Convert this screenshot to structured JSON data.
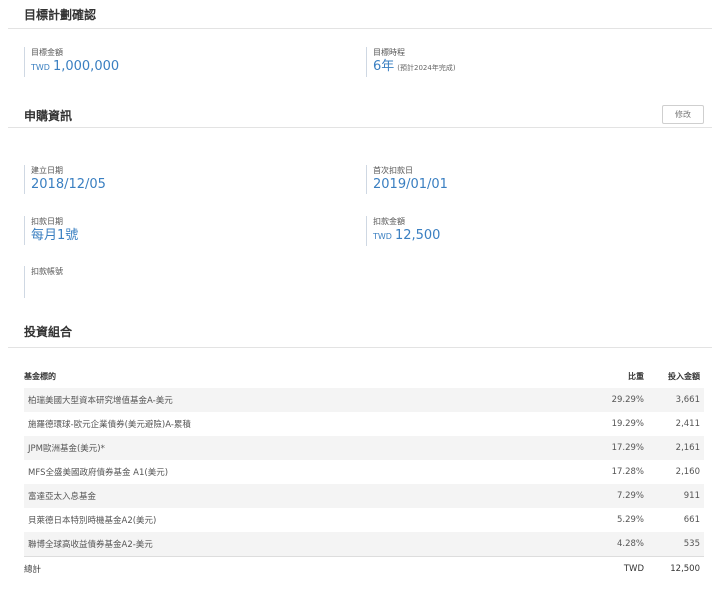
{
  "goal": {
    "title": "目標計劃確認",
    "amount_label": "目標金額",
    "amount_currency": "TWD",
    "amount_value": "1,000,000",
    "period_label": "目標時程",
    "period_value": "6年",
    "period_note": "(預計2024年完成)"
  },
  "purchase": {
    "title": "申購資訊",
    "edit_label": "修改",
    "created_label": "建立日期",
    "created_value": "2018/12/05",
    "first_debit_label": "首次扣款日",
    "first_debit_value": "2019/01/01",
    "debit_date_label": "扣款日期",
    "debit_date_value": "每月1號",
    "debit_amount_label": "扣款金額",
    "debit_amount_currency": "TWD",
    "debit_amount_value": "12,500",
    "account_label": "扣款帳號",
    "account_value": ""
  },
  "portfolio": {
    "title": "投資組合",
    "headers": {
      "fund": "基金標的",
      "ratio": "比重",
      "amount": "投入金額"
    },
    "rows": [
      {
        "fund": "柏瑞美國大型資本研究增值基金A-美元",
        "ratio": "29.29%",
        "amount": "3,661"
      },
      {
        "fund": "施羅德環球-歐元企業債券(美元避險)A-累積",
        "ratio": "19.29%",
        "amount": "2,411"
      },
      {
        "fund": "JPM歐洲基金(美元)*",
        "ratio": "17.29%",
        "amount": "2,161"
      },
      {
        "fund": "MFS全盛美國政府債券基金 A1(美元)",
        "ratio": "17.28%",
        "amount": "2,160"
      },
      {
        "fund": "富達亞太入息基金",
        "ratio": "7.29%",
        "amount": "911"
      },
      {
        "fund": "貝萊德日本特別時機基金A2(美元)",
        "ratio": "5.29%",
        "amount": "661"
      },
      {
        "fund": "聯博全球高收益債券基金A2-美元",
        "ratio": "4.28%",
        "amount": "535"
      }
    ],
    "total": {
      "label": "總計",
      "currency": "TWD",
      "amount": "12,500"
    }
  }
}
